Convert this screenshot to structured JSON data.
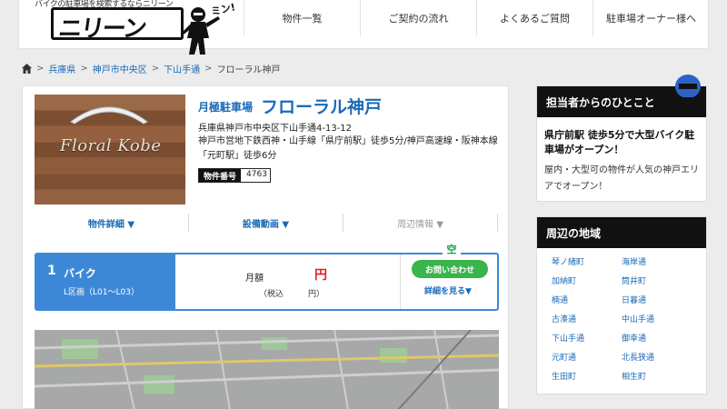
{
  "header": {
    "tagline": "バイクの駐車場を検索するならニリーン",
    "logo": "ニリーン",
    "mascot_bubble": "ミン!",
    "nav": [
      "物件一覧",
      "ご契約の流れ",
      "よくあるご質問",
      "駐車場オーナー様へ"
    ]
  },
  "breadcrumb": [
    "兵庫県",
    "神戸市中央区",
    "下山手通",
    "フローラル神戸"
  ],
  "property": {
    "photo_sign": "Floral Kobe",
    "lot_type": "月極駐車場",
    "name": "フローラル神戸",
    "address": "兵庫県神戸市中央区下山手通4-13-12",
    "access": "神戸市営地下鉄西神・山手線「県庁前駅」徒歩5分/神戸高速線・阪神本線「元町駅」徒歩6分",
    "property_no_label": "物件番号",
    "property_no": "4763"
  },
  "tabs": [
    "物件詳細 ▼",
    "設備動画 ▼",
    "周辺情報 ▼"
  ],
  "slot": {
    "num": "1",
    "name": "バイク",
    "zone": "L区画（L01〜L03）",
    "price_label": "月額",
    "price_unit": "円",
    "tax": "（税込　　　円）",
    "vacant": "空",
    "inquire": "お問い合わせ",
    "details": "詳細を見る▼"
  },
  "sidebar": {
    "message_head": "担当者からのひとこと",
    "message_title": "県庁前駅 徒歩5分で大型バイク駐車場がオープン！",
    "message_body": "屋内・大型可の物件が人気の神戸エリアでオープン！",
    "areas_head": "周辺の地域",
    "areas": [
      "琴ノ緒町",
      "海岸通",
      "加納町",
      "筒井町",
      "楠通",
      "日暮通",
      "古湊通",
      "中山手通",
      "下山手通",
      "御幸通",
      "元町通",
      "北長狭通",
      "生田町",
      "相生町"
    ]
  },
  "colors": {
    "brand_blue": "#3d88d6",
    "link_blue": "#1a6ab8",
    "price_red": "#e02020",
    "cta_green": "#39b54a"
  }
}
